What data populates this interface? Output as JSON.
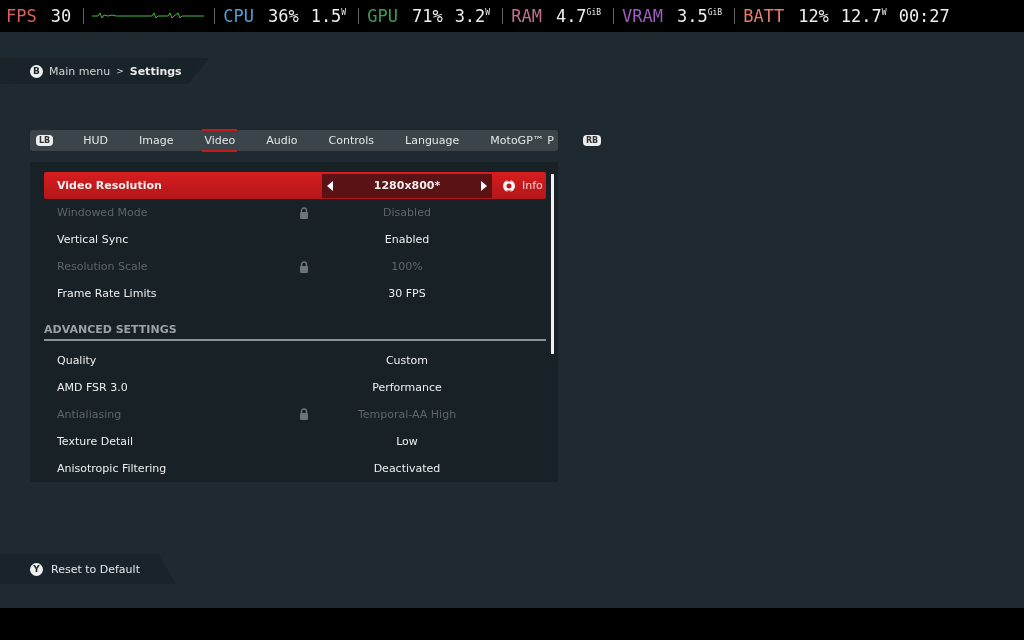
{
  "overlay": [
    {
      "label": "FPS",
      "color": "#d8605f",
      "values": [
        "30"
      ],
      "graph": true
    },
    {
      "label": "CPU",
      "color": "#4f9fd6",
      "values": [
        "36%",
        "1.5$^{W}$"
      ]
    },
    {
      "label": "GPU",
      "color": "#3f9a5a",
      "values": [
        "71%",
        "3.2$^{W}$"
      ]
    },
    {
      "label": "RAM",
      "color": "#c0708e",
      "values": [
        "4.7$^{GiB}$"
      ]
    },
    {
      "label": "VRAM",
      "color": "#a05cc0",
      "values": [
        "3.5$^{GiB}$"
      ]
    },
    {
      "label": "BATT",
      "color": "#e87b68",
      "values": [
        "12%",
        "12.7$^{W}$",
        "00:27"
      ]
    }
  ],
  "breadcrumb": {
    "button": "B",
    "parent": "Main menu",
    "separator": ">",
    "current": "Settings"
  },
  "tabs": {
    "left_button": "LB",
    "right_button": "RB",
    "items": [
      {
        "label": "HUD",
        "selected": false
      },
      {
        "label": "Image",
        "selected": false
      },
      {
        "label": "Video",
        "selected": true
      },
      {
        "label": "Audio",
        "selected": false
      },
      {
        "label": "Controls",
        "selected": false
      },
      {
        "label": "Language",
        "selected": false
      },
      {
        "label": "MotoGP™ P",
        "selected": false
      }
    ]
  },
  "rows": [
    {
      "kind": "setting",
      "label": "Video Resolution",
      "value": "1280x800*",
      "locked": false,
      "selected": true,
      "hint": "Info"
    },
    {
      "kind": "setting",
      "label": "Windowed Mode",
      "value": "Disabled",
      "locked": true,
      "selected": false
    },
    {
      "kind": "setting",
      "label": "Vertical Sync",
      "value": "Enabled",
      "locked": false,
      "selected": false
    },
    {
      "kind": "setting",
      "label": "Resolution Scale",
      "value": "100%",
      "locked": true,
      "selected": false
    },
    {
      "kind": "setting",
      "label": "Frame Rate Limits",
      "value": "30 FPS",
      "locked": false,
      "selected": false
    },
    {
      "kind": "section",
      "label": "ADVANCED SETTINGS"
    },
    {
      "kind": "setting",
      "label": "Quality",
      "value": "Custom",
      "locked": false,
      "selected": false
    },
    {
      "kind": "setting",
      "label": "AMD FSR 3.0",
      "value": "Performance",
      "locked": false,
      "selected": false
    },
    {
      "kind": "setting",
      "label": "Antialiasing",
      "value": "Temporal-AA High",
      "locked": true,
      "selected": false
    },
    {
      "kind": "setting",
      "label": "Texture Detail",
      "value": "Low",
      "locked": false,
      "selected": false
    },
    {
      "kind": "setting",
      "label": "Anisotropic Filtering",
      "value": "Deactivated",
      "locked": false,
      "selected": false
    }
  ],
  "footer": {
    "button": "Y",
    "label": "Reset to Default"
  }
}
